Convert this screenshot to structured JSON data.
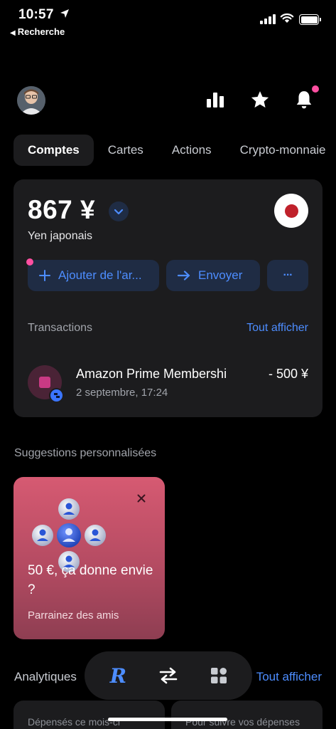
{
  "status_bar": {
    "time": "10:57",
    "back_label": "Recherche"
  },
  "header": {
    "icons": [
      "analytics-icon",
      "star-icon",
      "bell-icon"
    ],
    "notification_dot_color": "#ff4fa1"
  },
  "tabs": [
    {
      "label": "Comptes",
      "active": true
    },
    {
      "label": "Cartes",
      "active": false
    },
    {
      "label": "Actions",
      "active": false
    },
    {
      "label": "Crypto-monnaie",
      "active": false
    }
  ],
  "account": {
    "balance": "867 ¥",
    "currency_name": "Yen japonais",
    "flag": "japan-flag",
    "actions": {
      "add_label": "Ajouter de l'ar...",
      "send_label": "Envoyer",
      "more_label": "···"
    },
    "transactions_title": "Transactions",
    "see_all_label": "Tout afficher",
    "transactions": [
      {
        "name": "Amazon Prime Membershi",
        "date": "2 septembre, 17:24",
        "amount": "- 500 ¥"
      }
    ]
  },
  "suggestions": {
    "title": "Suggestions personnalisées",
    "promo": {
      "title": "50 €, ça donne envie ?",
      "subtitle": "Parrainez des amis"
    }
  },
  "analytics": {
    "title": "Analytiques",
    "see_all_label": "Tout afficher",
    "cards": [
      {
        "label": "Dépensés ce mois-ci"
      },
      {
        "label": "Pour suivre vos dépenses"
      }
    ]
  },
  "bottom_nav": {
    "items": [
      "revolut-home-icon",
      "transfer-icon",
      "hub-icon"
    ],
    "home_glyph": "R"
  },
  "colors": {
    "accent": "#4d8dff",
    "card_bg": "#1c1c1e",
    "promo_gradient_top": "#d65a72",
    "pink_dot": "#ff4fa1"
  }
}
